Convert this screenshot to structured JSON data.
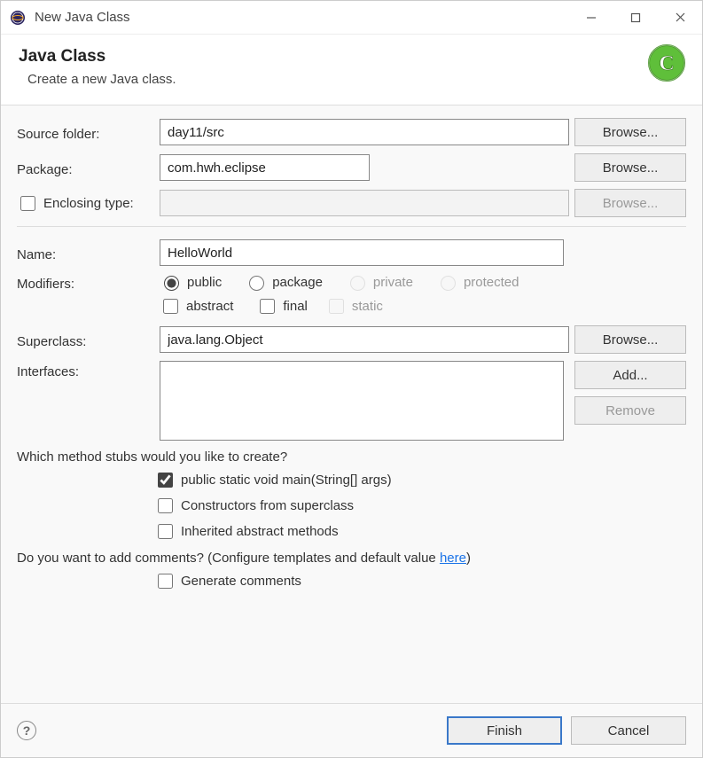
{
  "window": {
    "title": "New Java Class"
  },
  "banner": {
    "heading": "Java Class",
    "subtitle": "Create a new Java class."
  },
  "form": {
    "source_folder_label": "Source folder:",
    "source_folder_value": "day11/src",
    "package_label": "Package:",
    "package_value": "com.hwh.eclipse",
    "enclosing_type_label": "Enclosing type:",
    "enclosing_type_value": "",
    "name_label": "Name:",
    "name_value": "HelloWorld",
    "modifiers_label": "Modifiers:",
    "modifiers": {
      "public": "public",
      "package": "package",
      "private": "private",
      "protected": "protected",
      "abstract": "abstract",
      "final": "final",
      "static": "static"
    },
    "superclass_label": "Superclass:",
    "superclass_value": "java.lang.Object",
    "interfaces_label": "Interfaces:",
    "stubs_question": "Which method stubs would you like to create?",
    "stub_main": "public static void main(String[] args)",
    "stub_constructors": "Constructors from superclass",
    "stub_inherited": "Inherited abstract methods",
    "comments_question_prefix": "Do you want to add comments? (Configure templates and default value ",
    "comments_here": "here",
    "comments_question_suffix": ")",
    "generate_comments": "Generate comments"
  },
  "buttons": {
    "browse": "Browse...",
    "add": "Add...",
    "remove": "Remove",
    "finish": "Finish",
    "cancel": "Cancel"
  }
}
